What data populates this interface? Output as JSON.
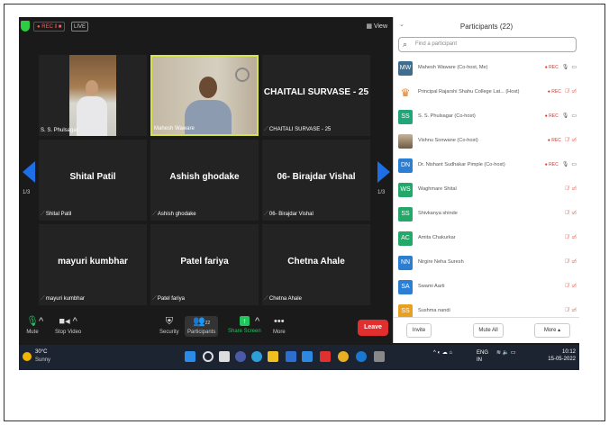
{
  "topbar": {
    "rec_label": "● REC ‖ ■",
    "live_label": "LIVE",
    "view_label": "View"
  },
  "tiles": [
    {
      "name_center": "",
      "label": "S. S. Phulsagar",
      "muted": false
    },
    {
      "name_center": "",
      "label": "Mahesh Waware",
      "muted": false
    },
    {
      "name_center": "CHAITALI SURVASE - 25",
      "label": "CHAITALI SURVASE - 25",
      "muted": true
    },
    {
      "name_center": "Shital Patil",
      "label": "Shital Patil",
      "muted": true
    },
    {
      "name_center": "Ashish ghodake",
      "label": "Ashish ghodake",
      "muted": true
    },
    {
      "name_center": "06- Birajdar Vishal",
      "label": "06- Birajdar Vishal",
      "muted": true
    },
    {
      "name_center": "mayuri kumbhar",
      "label": "mayuri kumbhar",
      "muted": true
    },
    {
      "name_center": "Patel fariya",
      "label": "Patel fariya",
      "muted": true
    },
    {
      "name_center": "Chetna Ahale",
      "label": "Chetna Ahale",
      "muted": true
    }
  ],
  "pager": {
    "left": "1/3",
    "right": "1/3"
  },
  "toolbar": {
    "mute": "Mute",
    "stop_video": "Stop Video",
    "security": "Security",
    "participants": "Participants",
    "participants_count": "22",
    "share_screen": "Share Screen",
    "more": "More",
    "leave": "Leave"
  },
  "panel": {
    "title": "Participants (22)",
    "search_placeholder": "Find a participant",
    "participants": [
      {
        "initials": "MW",
        "color": "#3c6e91",
        "name": "Mahesh Waware (Co-host, Me)",
        "rec": true,
        "mic": "on",
        "cam": "on"
      },
      {
        "initials": "",
        "color": "#ffffff",
        "name": "Principal Rajarshi Shahu College Lat... (Host)",
        "rec": true,
        "mic": "off",
        "cam": "off",
        "logo": true
      },
      {
        "initials": "SS",
        "color": "#21a67a",
        "name": "S. S. Phulsagar (Co-host)",
        "rec": true,
        "mic": "on",
        "cam": "on"
      },
      {
        "initials": "",
        "color": "#a88c70",
        "name": "Vishnu Sonwane (Co-host)",
        "rec": true,
        "mic": "off",
        "cam": "off",
        "photo": true
      },
      {
        "initials": "DN",
        "color": "#2a7fd4",
        "name": "Dr. Nishant Sudhakar Pimple (Co-host)",
        "rec": true,
        "mic": "on",
        "cam": "on"
      },
      {
        "initials": "WS",
        "color": "#23a869",
        "name": "Waghmare Shital",
        "rec": false,
        "mic": "off",
        "cam": "off"
      },
      {
        "initials": "SS",
        "color": "#23a869",
        "name": "Shivkanya shinde",
        "rec": false,
        "mic": "off",
        "cam": "off"
      },
      {
        "initials": "AC",
        "color": "#23a869",
        "name": "Amita Chakurkar",
        "rec": false,
        "mic": "off",
        "cam": "off"
      },
      {
        "initials": "NN",
        "color": "#2a7fd4",
        "name": "Nirgire Neha Suresh",
        "rec": false,
        "mic": "off",
        "cam": "off"
      },
      {
        "initials": "SA",
        "color": "#2a7fd4",
        "name": "Swami Aarti",
        "rec": false,
        "mic": "off",
        "cam": "off"
      },
      {
        "initials": "SS",
        "color": "#e8a020",
        "name": "Sushma nandi",
        "rec": false,
        "mic": "off",
        "cam": "off"
      }
    ],
    "invite": "Invite",
    "mute_all": "Mute All",
    "more": "More ▴"
  },
  "taskbar": {
    "temp": "30°C",
    "weather": "Sunny",
    "lang_top": "ENG",
    "lang_bottom": "IN",
    "time": "10:12",
    "date": "15-05-2022"
  },
  "colors": {
    "leave": "#e02f2f",
    "active_border": "#d7e34a",
    "muted_icon": "#e74c3c",
    "arrow": "#1d6fe8"
  }
}
